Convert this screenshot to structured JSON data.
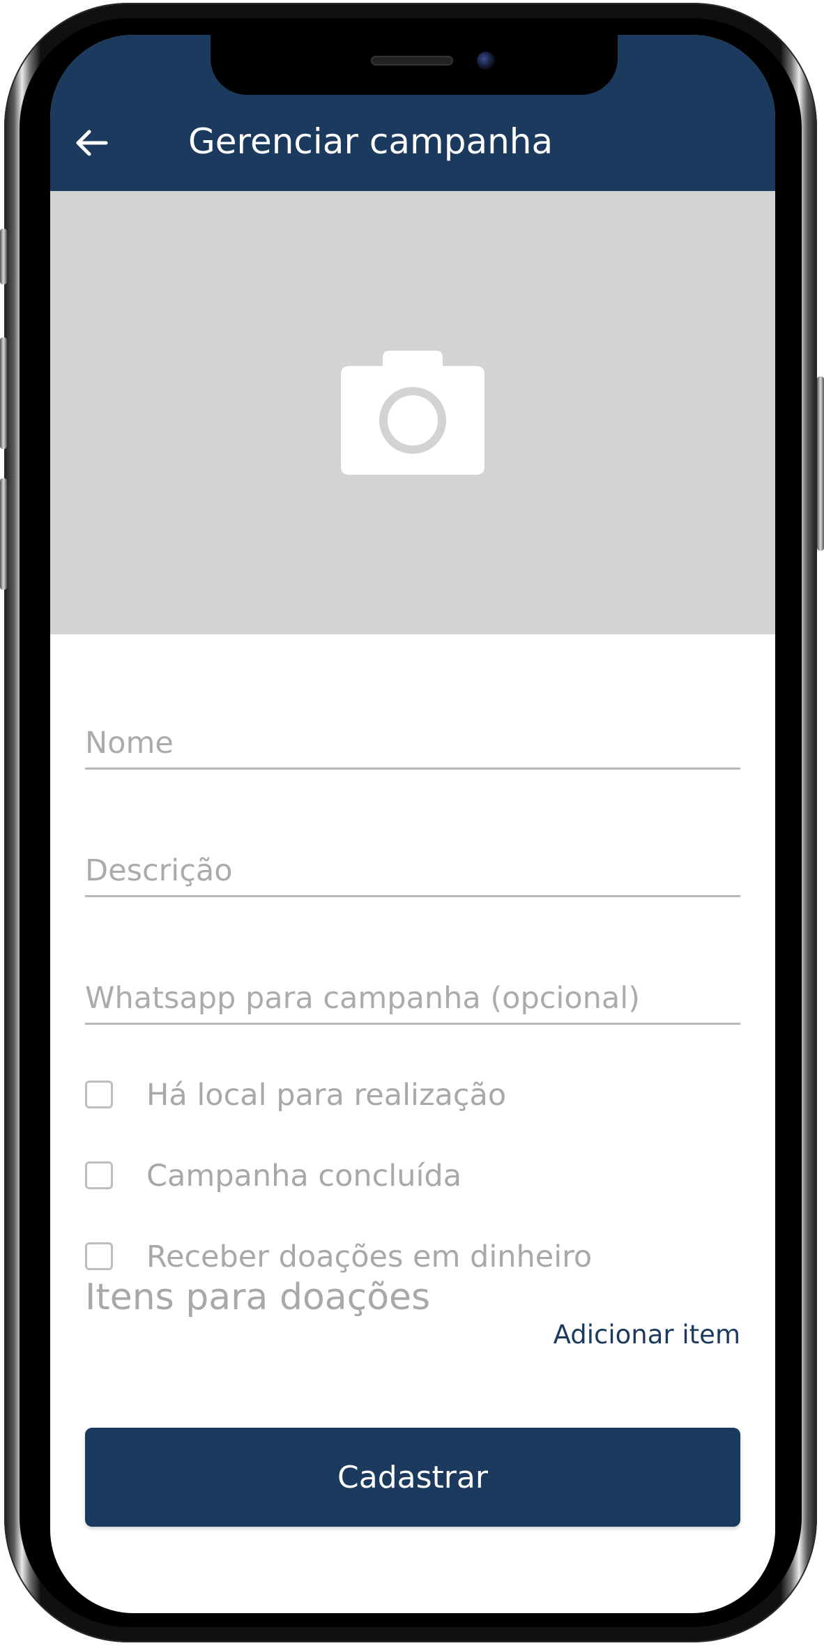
{
  "header": {
    "title": "Gerenciar campanha",
    "back_icon": "arrow-left-icon"
  },
  "image_picker": {
    "icon": "camera-icon"
  },
  "form": {
    "name_placeholder": "Nome",
    "description_placeholder": "Descrição",
    "whatsapp_placeholder": "Whatsapp para campanha (opcional)",
    "checkboxes": [
      {
        "label": "Há local para realização",
        "checked": false
      },
      {
        "label": "Campanha concluída",
        "checked": false
      },
      {
        "label": "Receber doações em dinheiro",
        "checked": false
      }
    ],
    "items_section_title": "Itens para doações",
    "add_item_label": "Adicionar item",
    "submit_label": "Cadastrar"
  },
  "colors": {
    "primary": "#1c3a5e",
    "image_placeholder_bg": "#d3d3d3",
    "muted_text": "#a8a8a8",
    "field_underline": "#b8b8b8"
  }
}
